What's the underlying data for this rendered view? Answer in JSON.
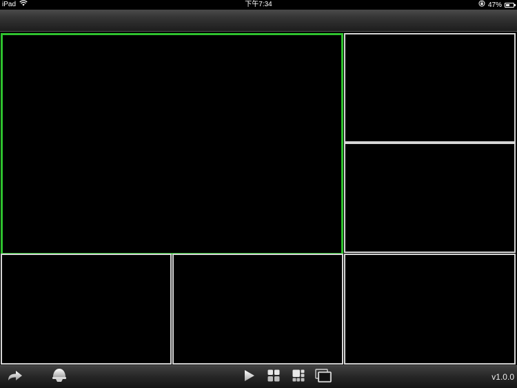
{
  "status_bar": {
    "device": "iPad",
    "time": "下午7:34",
    "battery_percent_label": "47%",
    "battery_level": 0.47
  },
  "grid": {
    "cells": [
      {
        "id": "channel-1",
        "selected": true
      },
      {
        "id": "channel-2",
        "selected": false
      },
      {
        "id": "channel-3",
        "selected": false
      },
      {
        "id": "channel-4",
        "selected": false
      },
      {
        "id": "channel-5",
        "selected": false
      },
      {
        "id": "channel-6",
        "selected": false
      }
    ],
    "selected_color": "#2ec22e",
    "border_color": "#d6d6d6"
  },
  "toolbar": {
    "icons": [
      "share-arrow-icon",
      "ptz-dome-camera-icon",
      "play-icon",
      "grid-2x2-icon",
      "grid-1plus5-icon",
      "single-window-icon"
    ],
    "version": "v1.0.0"
  }
}
